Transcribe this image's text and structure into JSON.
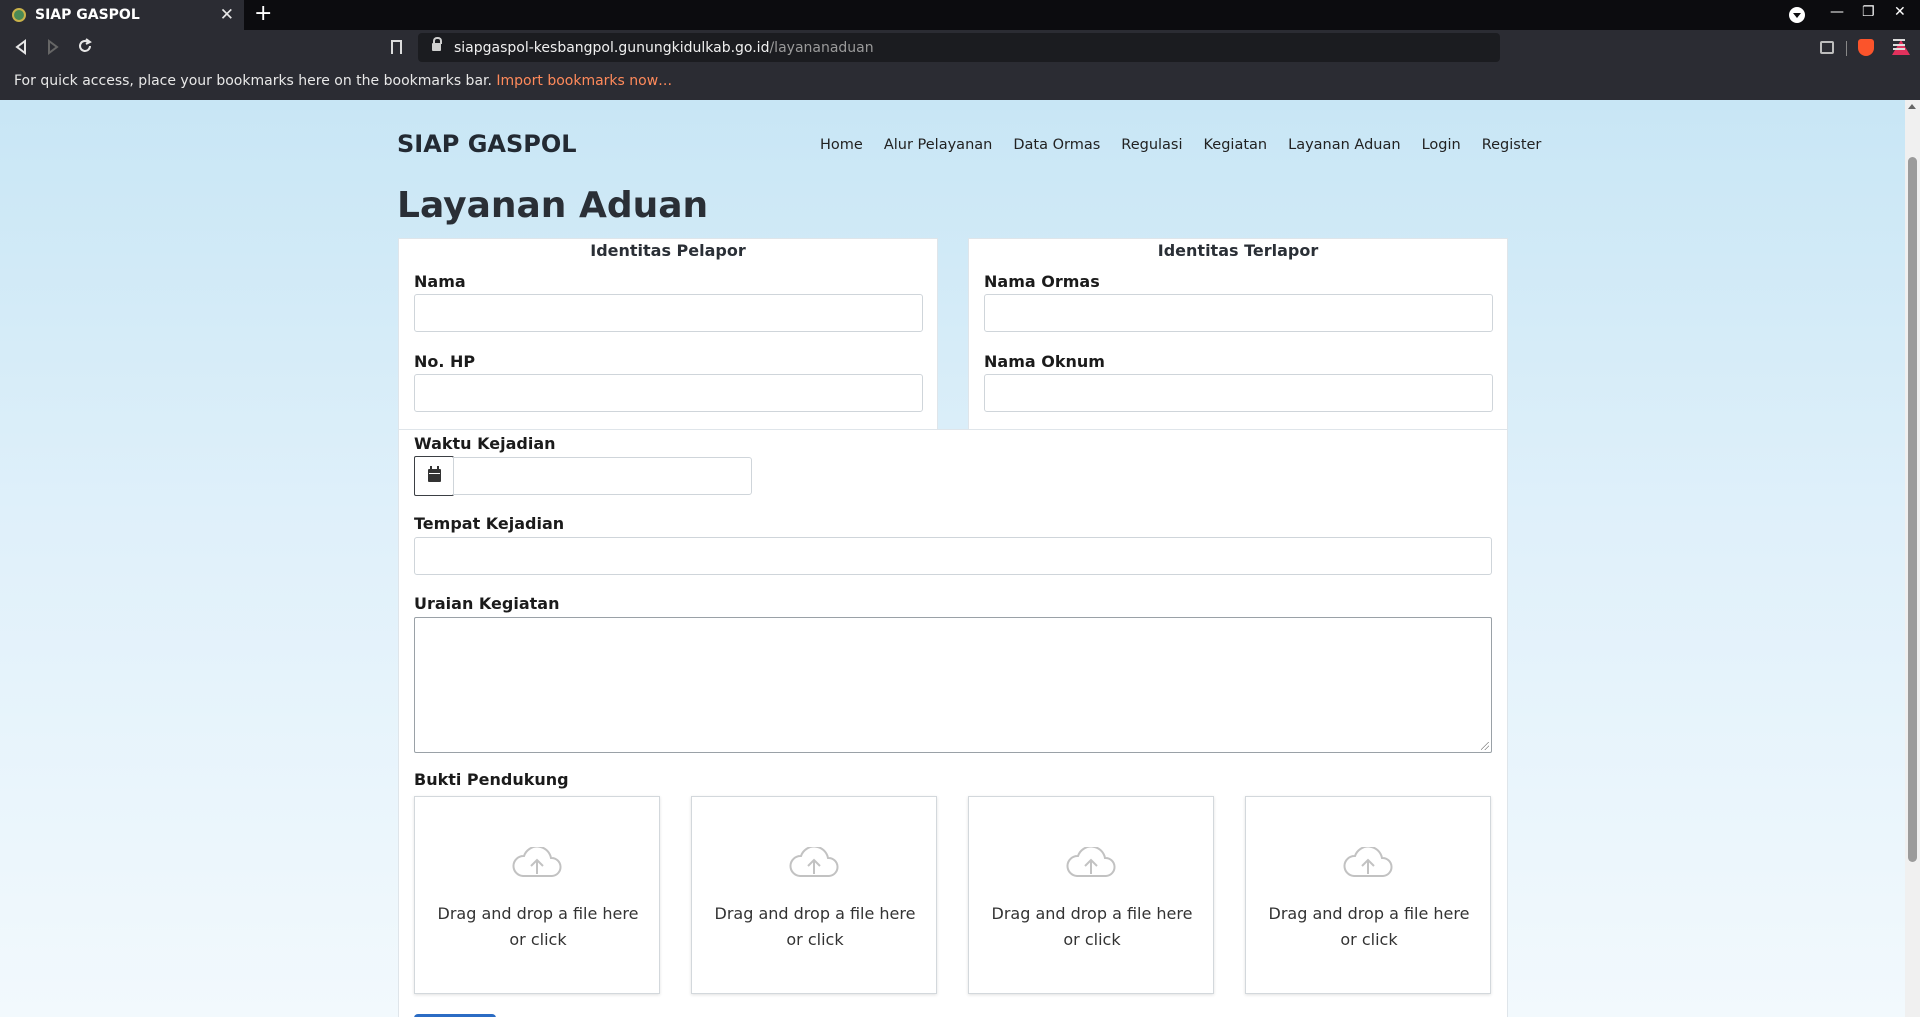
{
  "browser": {
    "tab_title": "SIAP GASPOL",
    "tab_close": "✕",
    "new_tab": "+",
    "url_host": "siapgaspol-kesbangpol.gunungkidulkab.go.id",
    "url_path": "/layananaduan",
    "bookmarks_message": "For quick access, place your bookmarks here on the bookmarks bar.",
    "bookmarks_import": "Import bookmarks now…",
    "window_minimize": "—",
    "window_restore": "❐",
    "window_close": "✕"
  },
  "site": {
    "brand": "SIAP GASPOL",
    "nav": [
      "Home",
      "Alur Pelayanan",
      "Data Ormas",
      "Regulasi",
      "Kegiatan",
      "Layanan Aduan",
      "Login",
      "Register"
    ]
  },
  "page": {
    "title": "Layanan Aduan",
    "pelapor": {
      "title": "Identitas Pelapor",
      "nama_label": "Nama",
      "hp_label": "No. HP"
    },
    "terlapor": {
      "title": "Identitas Terlapor",
      "ormas_label": "Nama Ormas",
      "oknum_label": "Nama Oknum"
    },
    "waktu_label": "Waktu Kejadian",
    "tempat_label": "Tempat Kejadian",
    "uraian_label": "Uraian Kegiatan",
    "bukti_label": "Bukti Pendukung",
    "dropzone_text": "Drag and drop a file here or click"
  },
  "icons": {
    "back": "back-arrow-icon",
    "forward": "forward-arrow-icon",
    "reload": "reload-icon",
    "bookmark": "bookmark-icon",
    "lock": "lock-icon",
    "calendar": "calendar-icon",
    "upload": "cloud-upload-icon"
  },
  "colors": {
    "page_gradient_top": "#c8e6f5",
    "import_link": "#ff8a5b",
    "submit_button": "#2b6cc4"
  }
}
